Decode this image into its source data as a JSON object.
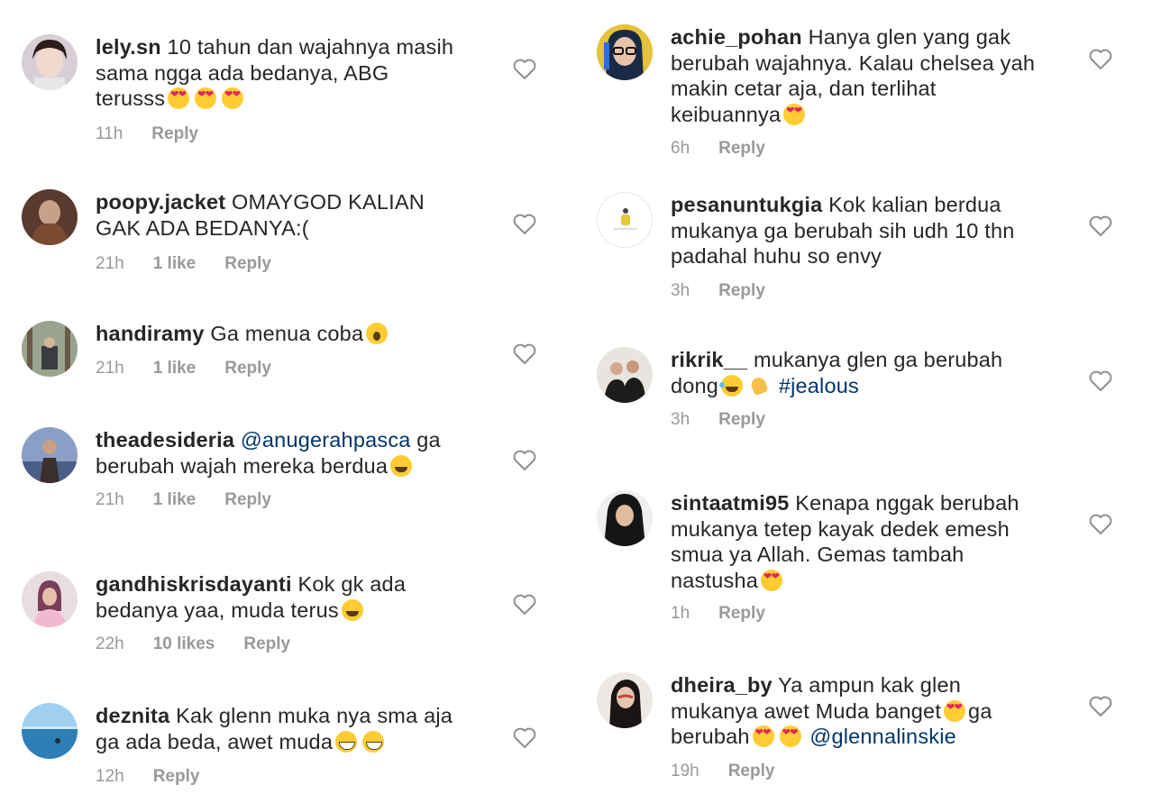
{
  "left_comments": [
    {
      "username": "lely.sn",
      "text_parts": [
        "10 tahun dan wajahnya masih",
        "sama ngga ada bedanya, ABG",
        "terusss"
      ],
      "emojis": [
        "heart-eyes-emoji",
        "heart-eyes-emoji",
        "heart-eyes-emoji"
      ],
      "time": "11h",
      "likes": "",
      "reply": "Reply"
    },
    {
      "username": "poopy.jacket",
      "text_parts": [
        "OMAYGOD KALIAN",
        "GAK ADA BEDANYA:("
      ],
      "time": "21h",
      "likes": "1 like",
      "reply": "Reply"
    },
    {
      "username": "handiramy",
      "text_parts": [
        "Ga menua coba"
      ],
      "emojis": [
        "screaming-face-emoji"
      ],
      "time": "21h",
      "likes": "1 like",
      "reply": "Reply"
    },
    {
      "username": "theadesideria",
      "mention": "@anugerahpasca",
      "text_parts": [
        "ga",
        "berubah wajah mereka berdua"
      ],
      "emojis": [
        "grinning-sweat-emoji"
      ],
      "time": "21h",
      "likes": "1 like",
      "reply": "Reply"
    },
    {
      "username": "gandhiskrisdayanti",
      "text_parts": [
        "Kok gk ada",
        "bedanya yaa, muda terus"
      ],
      "emojis": [
        "squinting-face-emoji"
      ],
      "time": "22h",
      "likes": "10 likes",
      "reply": "Reply"
    },
    {
      "username": "deznita",
      "text_parts": [
        "Kak glenn muka nya sma aja",
        "ga ada beda, awet muda"
      ],
      "emojis": [
        "grinning-face-emoji",
        "grinning-face-emoji"
      ],
      "time": "12h",
      "likes": "",
      "reply": "Reply"
    }
  ],
  "right_comments": [
    {
      "username": "achie_pohan",
      "text_parts": [
        "Hanya glen yang gak",
        "berubah wajahnya. Kalau chelsea yah",
        "makin cetar aja, dan terlihat",
        "keibuannya"
      ],
      "emojis": [
        "heart-eyes-emoji"
      ],
      "time": "6h",
      "likes": "",
      "reply": "Reply"
    },
    {
      "username": "pesanuntukgia",
      "text_parts": [
        "Kok kalian berdua",
        "mukanya ga berubah sih udh 10 thn",
        "padahal huhu so envy"
      ],
      "time": "3h",
      "likes": "",
      "reply": "Reply"
    },
    {
      "username": "rikrik__",
      "text_parts": [
        "mukanya glen ga berubah",
        "dong"
      ],
      "emojis": [
        "joy-emoji",
        "clapping-hands-emoji"
      ],
      "hashtag": "#jealous",
      "time": "3h",
      "likes": "",
      "reply": "Reply"
    },
    {
      "username": "sintaatmi95",
      "text_parts": [
        "Kenapa nggak berubah",
        "mukanya tetep kayak dedek emesh",
        "smua ya Allah. Gemas tambah",
        "nastusha"
      ],
      "emojis": [
        "heart-eyes-emoji"
      ],
      "time": "1h",
      "likes": "",
      "reply": "Reply"
    },
    {
      "username": "dheira_by",
      "text_parts": [
        "Ya ampun kak glen",
        "mukanya awet Muda banget",
        "ga",
        "berubah"
      ],
      "emojis": [
        "heart-eyes-emoji",
        "heart-eyes-emoji",
        "heart-eyes-emoji"
      ],
      "mention": "@glennalinskie",
      "time": "19h",
      "likes": "",
      "reply": "Reply"
    }
  ],
  "colors": {
    "text": "#262626",
    "meta": "#999999",
    "mention": "#003569",
    "heart_outline": "#8e8e8e"
  },
  "icons": {
    "like": "heart-outline-icon"
  }
}
